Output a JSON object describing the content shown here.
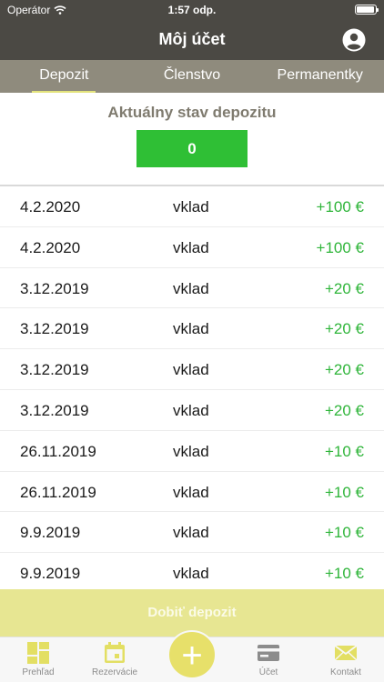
{
  "status": {
    "carrier": "Operátor",
    "time": "1:57 odp.",
    "icons": [
      "wifi-icon",
      "battery-icon"
    ]
  },
  "header": {
    "title": "Môj účet",
    "profile_icon": "account-circle-icon"
  },
  "tabs": [
    {
      "label": "Depozit",
      "active": true
    },
    {
      "label": "Členstvo",
      "active": false
    },
    {
      "label": "Permanentky",
      "active": false
    }
  ],
  "deposit": {
    "title": "Aktuálny stav depozitu",
    "balance": "0"
  },
  "transactions": [
    {
      "date": "4.2.2020",
      "type": "vklad",
      "amount": "+100 €"
    },
    {
      "date": "4.2.2020",
      "type": "vklad",
      "amount": "+100 €"
    },
    {
      "date": "3.12.2019",
      "type": "vklad",
      "amount": "+20 €"
    },
    {
      "date": "3.12.2019",
      "type": "vklad",
      "amount": "+20 €"
    },
    {
      "date": "3.12.2019",
      "type": "vklad",
      "amount": "+20 €"
    },
    {
      "date": "3.12.2019",
      "type": "vklad",
      "amount": "+20 €"
    },
    {
      "date": "26.11.2019",
      "type": "vklad",
      "amount": "+10 €"
    },
    {
      "date": "26.11.2019",
      "type": "vklad",
      "amount": "+10 €"
    },
    {
      "date": "9.9.2019",
      "type": "vklad",
      "amount": "+10 €"
    },
    {
      "date": "9.9.2019",
      "type": "vklad",
      "amount": "+10 €"
    }
  ],
  "topup_label": "Dobiť depozit",
  "tab_bar": {
    "items": [
      {
        "label": "Prehľad",
        "icon": "dashboard-icon"
      },
      {
        "label": "Rezervácie",
        "icon": "calendar-icon"
      },
      {
        "label": "",
        "icon": "plus-icon"
      },
      {
        "label": "Účet",
        "icon": "credit-card-icon"
      },
      {
        "label": "Kontakt",
        "icon": "mail-icon"
      }
    ],
    "plus_symbol": "+"
  },
  "colors": {
    "header_bg": "#4b4944",
    "tabs_bg": "#8f8b7d",
    "accent_yellow": "#e3e37c",
    "balance_green": "#2fbf35",
    "amount_green": "#2fb53a"
  }
}
